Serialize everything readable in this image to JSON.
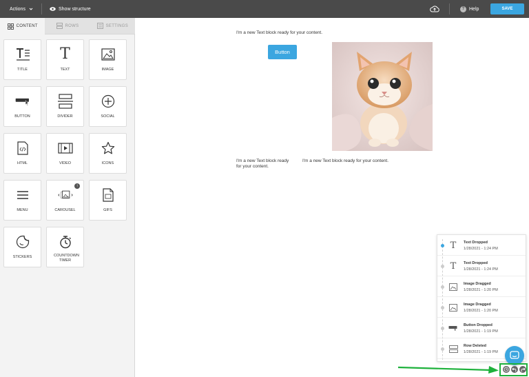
{
  "topbar": {
    "actions_label": "Actions",
    "show_structure_label": "Show structure",
    "help_label": "Help",
    "save_label": "SAVE",
    "cloud_icon": "cloud-upload-icon"
  },
  "sidebar": {
    "tabs": [
      {
        "label": "CONTENT",
        "icon": "grid-icon",
        "active": true
      },
      {
        "label": "ROWS",
        "icon": "rows-icon",
        "active": false
      },
      {
        "label": "SETTINGS",
        "icon": "settings-icon",
        "active": false
      }
    ],
    "tiles": [
      {
        "label": "TITLE",
        "icon": "title-icon"
      },
      {
        "label": "TEXT",
        "icon": "text-icon"
      },
      {
        "label": "IMAGE",
        "icon": "image-icon"
      },
      {
        "label": "BUTTON",
        "icon": "button-icon"
      },
      {
        "label": "DIVIDER",
        "icon": "divider-icon"
      },
      {
        "label": "SOCIAL",
        "icon": "social-icon"
      },
      {
        "label": "HTML",
        "icon": "html-icon"
      },
      {
        "label": "VIDEO",
        "icon": "video-icon"
      },
      {
        "label": "ICONS",
        "icon": "star-icon"
      },
      {
        "label": "MENU",
        "icon": "menu-icon"
      },
      {
        "label": "CAROUSEL",
        "icon": "carousel-icon"
      },
      {
        "label": "GIFS",
        "icon": "gif-icon"
      },
      {
        "label": "STICKERS",
        "icon": "sticker-icon"
      },
      {
        "label": "COUNTDOWN TIMER",
        "icon": "timer-icon"
      }
    ]
  },
  "canvas": {
    "text_top": "I'm a new Text block ready for your content.",
    "button_label": "Button",
    "text_left_line1": "I'm a new Text block ready",
    "text_left_line2": "for your content.",
    "text_right": "I'm a new Text block ready for your content.",
    "image_icon": "cat-photo"
  },
  "history": {
    "items": [
      {
        "title": "Text Dropped",
        "date": "1/28/2021 - 1:24 PM",
        "icon": "text-icon",
        "active": true
      },
      {
        "title": "Text Dropped",
        "date": "1/28/2021 - 1:24 PM",
        "icon": "text-icon",
        "active": false
      },
      {
        "title": "Image Dragged",
        "date": "1/28/2021 - 1:20 PM",
        "icon": "image-icon",
        "active": false
      },
      {
        "title": "Image Dragged",
        "date": "1/28/2021 - 1:20 PM",
        "icon": "image-icon",
        "active": false
      },
      {
        "title": "Button Dropped",
        "date": "1/28/2021 - 1:19 PM",
        "icon": "button-icon",
        "active": false
      },
      {
        "title": "Row Deleted",
        "date": "1/28/2021 - 1:19 PM",
        "icon": "row-icon",
        "active": false
      }
    ]
  },
  "colors": {
    "accent": "#3ba6e0",
    "topbar": "#4a4a4a",
    "highlight": "#1db13b"
  }
}
